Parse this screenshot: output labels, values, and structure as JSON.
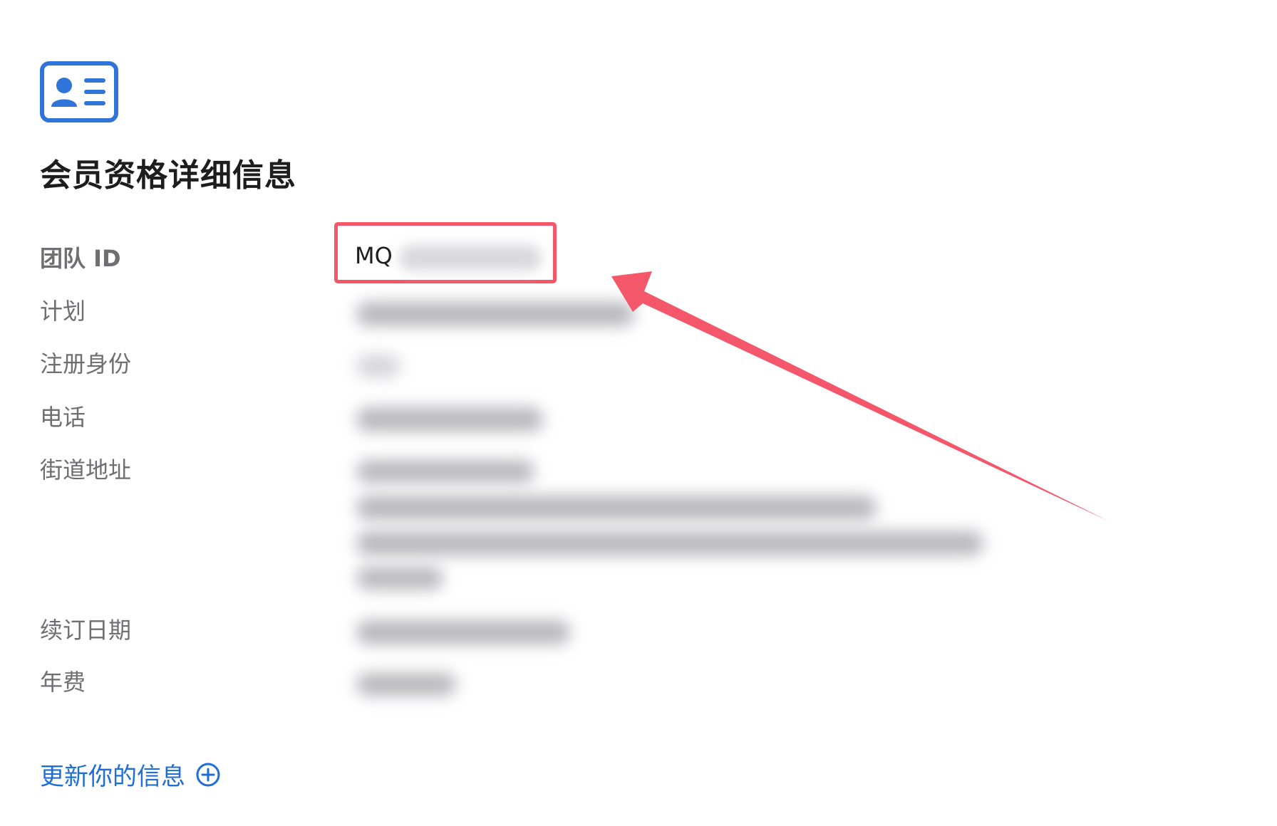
{
  "header": {
    "icon": "contact-card-icon",
    "title": "会员资格详细信息"
  },
  "fields": [
    {
      "label": "团队 ID",
      "value_visible": "MQ"
    },
    {
      "label": "计划"
    },
    {
      "label": "注册身份"
    },
    {
      "label": "电话"
    },
    {
      "label": "街道地址"
    },
    {
      "label": "续订日期"
    },
    {
      "label": "年费"
    }
  ],
  "update_link": {
    "label": "更新你的信息",
    "icon": "plus-circle-icon"
  },
  "colors": {
    "accent": "#1f6ed8",
    "highlight": "#f4566a",
    "label": "#6e6e73",
    "title": "#1d1d1f"
  }
}
